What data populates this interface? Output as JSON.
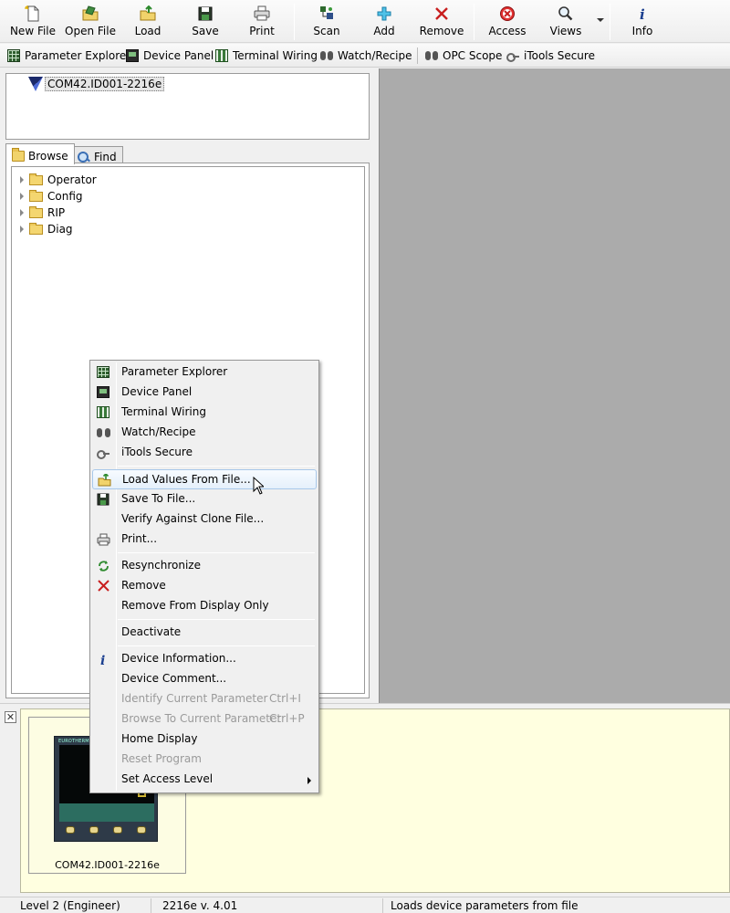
{
  "toolbar": {
    "buttons": [
      {
        "label": "New File",
        "icon": "new-file-icon"
      },
      {
        "label": "Open File",
        "icon": "open-file-icon"
      },
      {
        "label": "Load",
        "icon": "load-icon"
      },
      {
        "label": "Save",
        "icon": "save-icon"
      },
      {
        "label": "Print",
        "icon": "print-icon"
      },
      {
        "label": "Scan",
        "icon": "scan-icon"
      },
      {
        "label": "Add",
        "icon": "add-icon"
      },
      {
        "label": "Remove",
        "icon": "remove-icon"
      },
      {
        "label": "Access",
        "icon": "access-icon"
      },
      {
        "label": "Views",
        "icon": "views-icon"
      },
      {
        "label": "Info",
        "icon": "info-icon"
      }
    ]
  },
  "toolbar2": {
    "items": [
      {
        "label": "Parameter Explorer"
      },
      {
        "label": "Device Panel"
      },
      {
        "label": "Terminal Wiring"
      },
      {
        "label": "Watch/Recipe"
      },
      {
        "label": "OPC Scope"
      },
      {
        "label": "iTools Secure"
      }
    ]
  },
  "device_tree": {
    "device": "COM42.ID001-2216e"
  },
  "tabs": {
    "browse": "Browse",
    "find": "Find"
  },
  "browse_tree": {
    "items": [
      {
        "label": "Operator"
      },
      {
        "label": "Config"
      },
      {
        "label": "RIP"
      },
      {
        "label": "Diag"
      }
    ]
  },
  "context_menu": {
    "items": [
      {
        "label": "Parameter Explorer"
      },
      {
        "label": "Device Panel"
      },
      {
        "label": "Terminal Wiring"
      },
      {
        "label": "Watch/Recipe"
      },
      {
        "label": "iTools Secure"
      },
      {
        "label": "Load Values From File..."
      },
      {
        "label": "Save To File..."
      },
      {
        "label": "Verify Against Clone File..."
      },
      {
        "label": "Print..."
      },
      {
        "label": "Resynchronize"
      },
      {
        "label": "Remove"
      },
      {
        "label": "Remove From Display Only"
      },
      {
        "label": "Deactivate"
      },
      {
        "label": "Device Information..."
      },
      {
        "label": "Device Comment..."
      },
      {
        "label": "Identify Current Parameter",
        "shortcut": "Ctrl+I"
      },
      {
        "label": "Browse To Current Parameter",
        "shortcut": "Ctrl+P"
      },
      {
        "label": "Home Display"
      },
      {
        "label": "Reset Program"
      },
      {
        "label": "Set Access Level"
      }
    ]
  },
  "bottom_panel": {
    "close_label": "✕",
    "device_label": "COM42.ID001-2216e",
    "device_brand": "EUROTHERM"
  },
  "statusbar": {
    "access_level": "Level 2 (Engineer)",
    "version": "2216e v. 4.01",
    "message": "Loads device parameters from file"
  },
  "colors": {
    "workspace_bg": "#ababab",
    "bottom_panel_bg": "#ffffe0",
    "highlight_border": "#a8c8ea"
  }
}
